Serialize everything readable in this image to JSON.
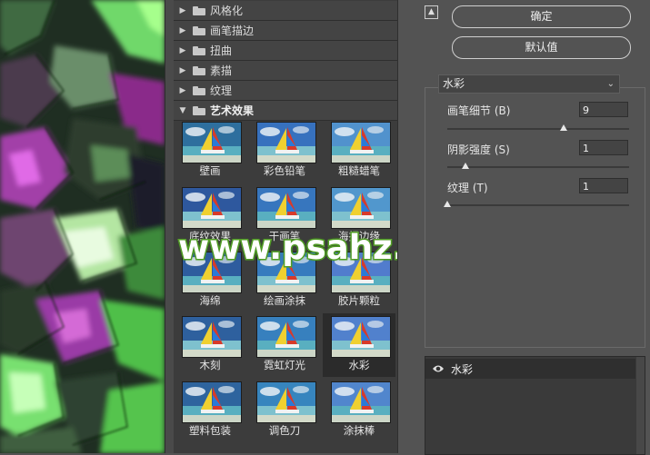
{
  "categories": [
    {
      "label": "风格化",
      "expanded": false
    },
    {
      "label": "画笔描边",
      "expanded": false
    },
    {
      "label": "扭曲",
      "expanded": false
    },
    {
      "label": "素描",
      "expanded": false
    },
    {
      "label": "纹理",
      "expanded": false
    },
    {
      "label": "艺术效果",
      "expanded": true
    }
  ],
  "filters": [
    {
      "label": "壁画"
    },
    {
      "label": "彩色铅笔"
    },
    {
      "label": "粗糙蜡笔"
    },
    {
      "label": "底纹效果"
    },
    {
      "label": "干画笔"
    },
    {
      "label": "海报边缘"
    },
    {
      "label": "海绵"
    },
    {
      "label": "绘画涂抹"
    },
    {
      "label": "胶片颗粒"
    },
    {
      "label": "木刻"
    },
    {
      "label": "霓虹灯光"
    },
    {
      "label": "水彩",
      "selected": true
    },
    {
      "label": "塑料包装"
    },
    {
      "label": "调色刀"
    },
    {
      "label": "涂抹棒"
    }
  ],
  "buttons": {
    "ok": "确定",
    "default": "默认值"
  },
  "filter_select": {
    "value": "水彩"
  },
  "params": [
    {
      "label": "画笔细节 (B)",
      "value": "9",
      "fraction": 0.64
    },
    {
      "label": "阴影强度 (S)",
      "value": "1",
      "fraction": 0.1
    },
    {
      "label": "纹理 (T)",
      "value": "1",
      "fraction": 0.0
    }
  ],
  "layers": [
    {
      "name": "水彩",
      "visible": true
    }
  ],
  "watermark": "www.psahz.com",
  "colors": {
    "panel_bg": "#535353",
    "list_bg": "#3c3c3c",
    "selected_bg": "#2b2b2b",
    "watermark_fill": "#ffffff",
    "watermark_stroke": "#5aa62a"
  },
  "icons": {
    "collapse": "collapse-icon",
    "expand_arrow": "triangle-right-icon",
    "collapse_arrow": "triangle-down-icon",
    "folder": "folder-icon",
    "visibility": "eye-icon",
    "dropdown": "chevron-down-icon"
  }
}
